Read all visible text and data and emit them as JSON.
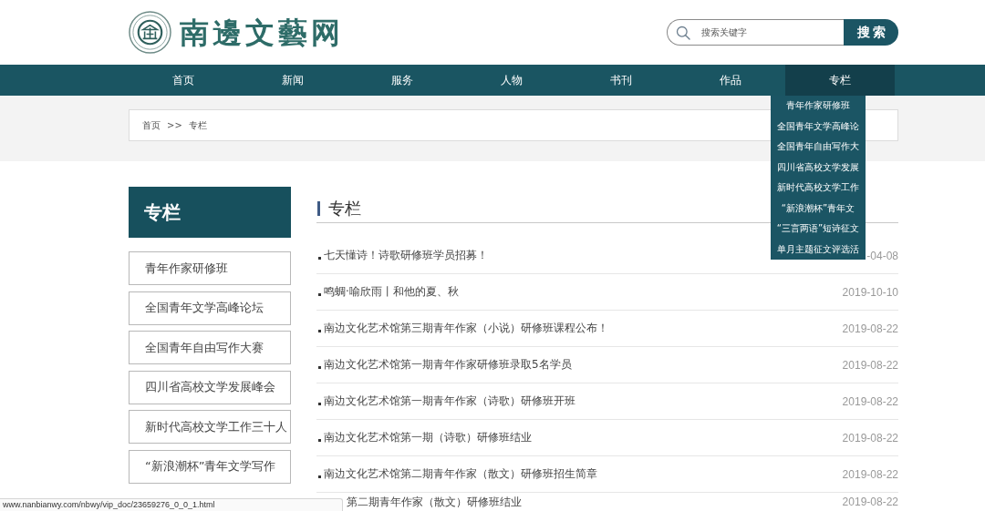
{
  "header": {
    "logo_text": "南邊文藝网",
    "search": {
      "placeholder": "搜索关键字",
      "button": "搜索"
    }
  },
  "nav": {
    "items": [
      {
        "label": "首页",
        "selected": false
      },
      {
        "label": "新闻",
        "selected": false
      },
      {
        "label": "服务",
        "selected": false
      },
      {
        "label": "人物",
        "selected": false
      },
      {
        "label": "书刊",
        "selected": false
      },
      {
        "label": "作品",
        "selected": false
      },
      {
        "label": "专栏",
        "selected": true,
        "menu": [
          "青年作家研修班",
          "全国青年文学高峰论",
          "全国青年自由写作大",
          "四川省高校文学发展",
          "新时代高校文学工作",
          "“新浪潮杯”青年文",
          "“三言两语”短诗征文",
          "单月主题征文评选活"
        ]
      }
    ]
  },
  "breadcrumb": {
    "items": [
      "首页",
      "专栏"
    ],
    "separator": ">>"
  },
  "sidebar": {
    "title": "专栏",
    "items": [
      "青年作家研修班",
      "全国青年文学高峰论坛",
      "全国青年自由写作大赛",
      "四川省高校文学发展峰会",
      "新时代高校文学工作三十人",
      "“新浪潮杯”青年文学写作"
    ]
  },
  "main": {
    "title": "专栏",
    "articles": [
      {
        "title": "七天懂诗！诗歌研修班学员招募！",
        "date": "-04-08"
      },
      {
        "title": "鸣蜩·喻欣雨丨和他的夏、秋",
        "date": "2019-10-10"
      },
      {
        "title": "南边文化艺术馆第三期青年作家（小说）研修班课程公布！",
        "date": "2019-08-22"
      },
      {
        "title": "南边文化艺术馆第一期青年作家研修班录取5名学员",
        "date": "2019-08-22"
      },
      {
        "title": "南边文化艺术馆第一期青年作家（诗歌）研修班开班",
        "date": "2019-08-22"
      },
      {
        "title": "南边文化艺术馆第一期（诗歌）研修班结业",
        "date": "2019-08-22"
      },
      {
        "title": "南边文化艺术馆第二期青年作家（散文）研修班招生简章",
        "date": "2019-08-22"
      },
      {
        "title": "第二期青年作家（散文）研修班结业",
        "date": "2019-08-22"
      }
    ]
  },
  "status_bar": {
    "url": "www.nanbianwy.com/nbwy/vip_doc/23659276_0_0_1.html"
  }
}
